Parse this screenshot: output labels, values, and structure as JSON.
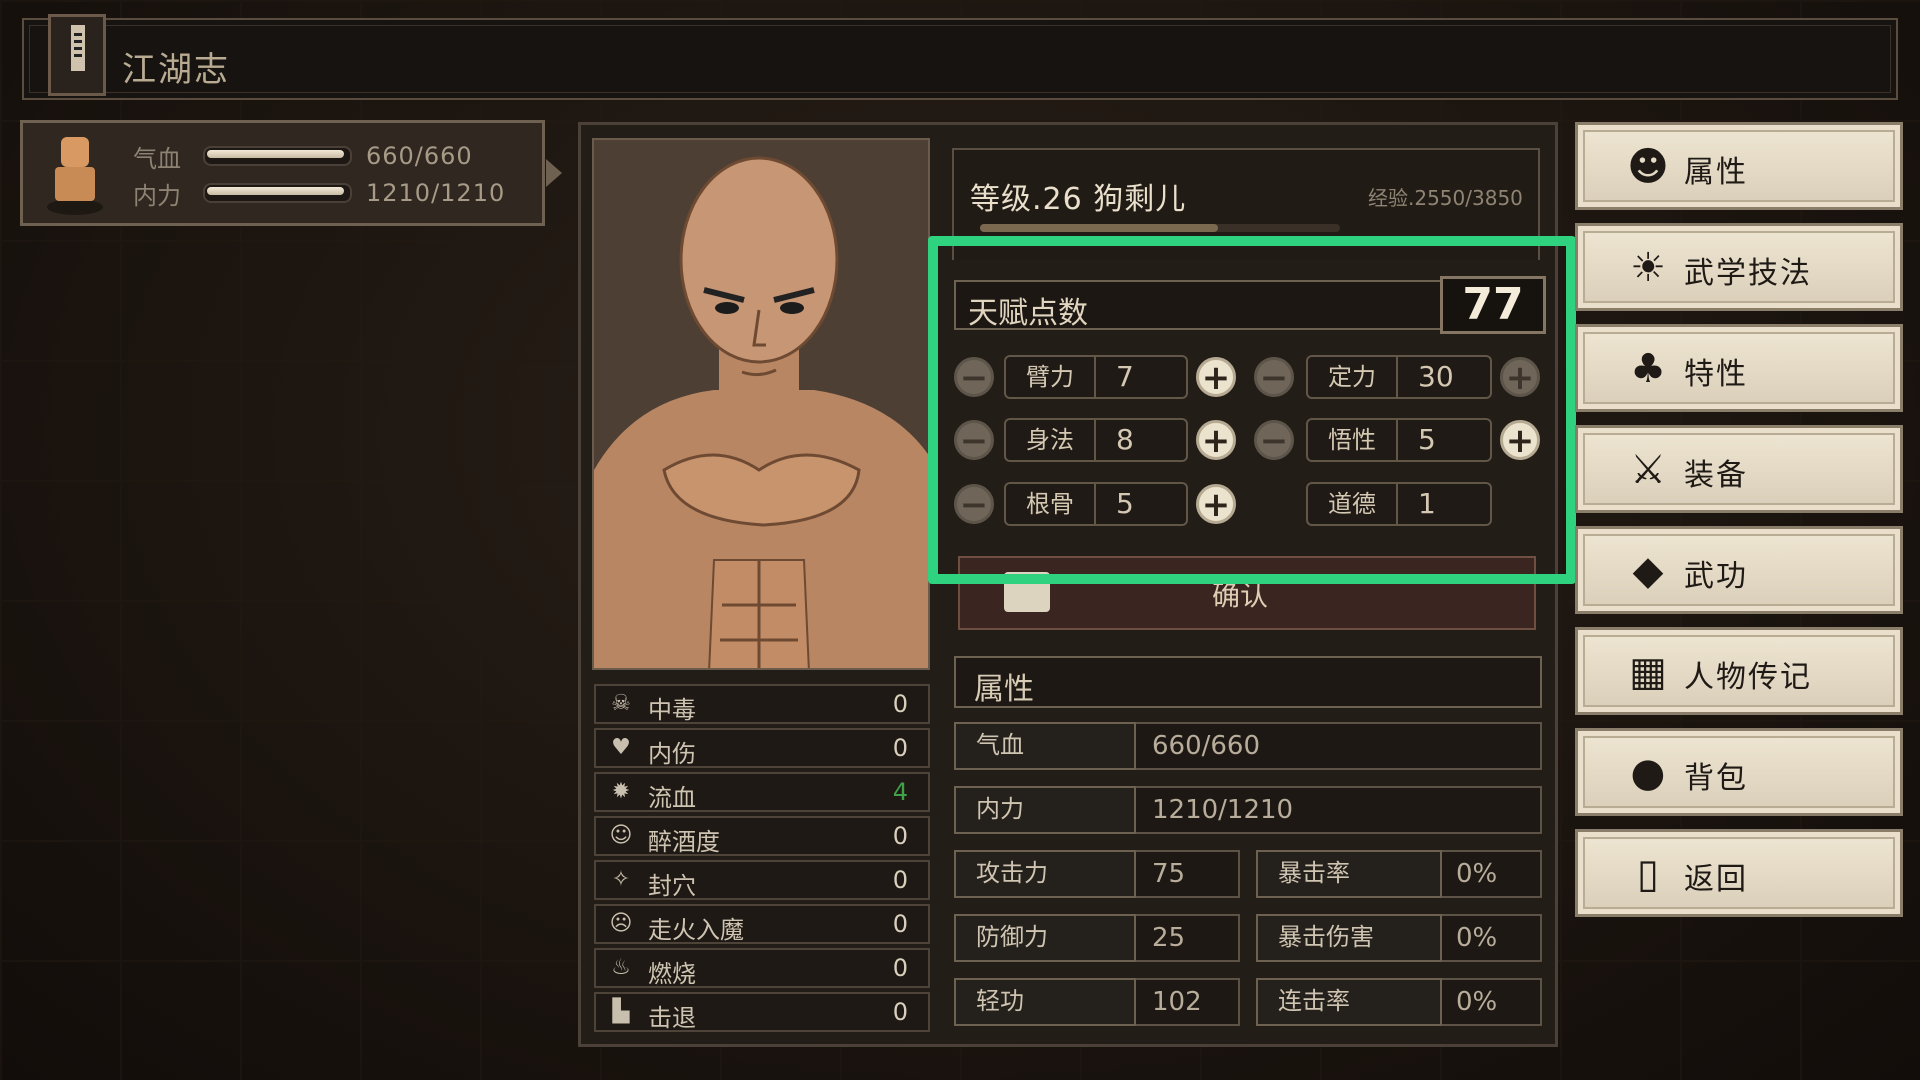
{
  "title": "江湖志",
  "status": {
    "hp_label": "气血",
    "hp_value": "660/660",
    "hp_fraction": 1.0,
    "mp_label": "内力",
    "mp_value": "1210/1210",
    "mp_fraction": 1.0
  },
  "character": {
    "level_text": "等级.26 狗剩儿",
    "exp_text": "经验.2550/3850",
    "exp_fraction": 0.66
  },
  "talent": {
    "label": "天赋点数",
    "value": "77"
  },
  "attributes": [
    {
      "name": "臂力",
      "value": "7",
      "minus": true,
      "plus": true
    },
    {
      "name": "定力",
      "value": "30",
      "minus": true,
      "plus": true
    },
    {
      "name": "身法",
      "value": "8",
      "minus": true,
      "plus": true
    },
    {
      "name": "悟性",
      "value": "5",
      "minus": true,
      "plus": true
    },
    {
      "name": "根骨",
      "value": "5",
      "minus": true,
      "plus": true
    },
    {
      "name": "道德",
      "value": "1",
      "minus": false,
      "plus": false
    }
  ],
  "confirm_label": "确认",
  "effects": [
    {
      "icon": "skull-icon",
      "glyph": "☠",
      "name": "中毒",
      "value": "0"
    },
    {
      "icon": "broken-heart-icon",
      "glyph": "♥",
      "name": "内伤",
      "value": "0"
    },
    {
      "icon": "blood-icon",
      "glyph": "✹",
      "name": "流血",
      "value": "4",
      "green": true
    },
    {
      "icon": "drunk-icon",
      "glyph": "☺",
      "name": "醉酒度",
      "value": "0"
    },
    {
      "icon": "acupoint-icon",
      "glyph": "✧",
      "name": "封穴",
      "value": "0"
    },
    {
      "icon": "demon-icon",
      "glyph": "☹",
      "name": "走火入魔",
      "value": "0"
    },
    {
      "icon": "fire-icon",
      "glyph": "♨",
      "name": "燃烧",
      "value": "0"
    },
    {
      "icon": "boot-icon",
      "glyph": "▙",
      "name": "击退",
      "value": "0"
    }
  ],
  "properties": {
    "heading": "属性",
    "hp": {
      "label": "气血",
      "value": "660/660"
    },
    "mp": {
      "label": "内力",
      "value": "1210/1210"
    },
    "attack": {
      "label": "攻击力",
      "value": "75"
    },
    "crit_rate": {
      "label": "暴击率",
      "value": "0%"
    },
    "defense": {
      "label": "防御力",
      "value": "25"
    },
    "crit_damage": {
      "label": "暴击伤害",
      "value": "0%"
    },
    "qinggong": {
      "label": "轻功",
      "value": "102"
    },
    "combo_rate": {
      "label": "连击率",
      "value": "0%"
    }
  },
  "menu": [
    {
      "icon": "person-icon",
      "glyph": "☻",
      "label": "属性"
    },
    {
      "icon": "martial-person-icon",
      "glyph": "☀",
      "label": "武学技法"
    },
    {
      "icon": "trait-icon",
      "glyph": "♣",
      "label": "特性"
    },
    {
      "icon": "sword-icon",
      "glyph": "⚔",
      "label": "装备"
    },
    {
      "icon": "scroll-book-icon",
      "glyph": "◆",
      "label": "武功"
    },
    {
      "icon": "biography-icon",
      "glyph": "▦",
      "label": "人物传记"
    },
    {
      "icon": "bag-icon",
      "glyph": "●",
      "label": "背包"
    },
    {
      "icon": "door-icon",
      "glyph": "▯",
      "label": "返回"
    }
  ]
}
